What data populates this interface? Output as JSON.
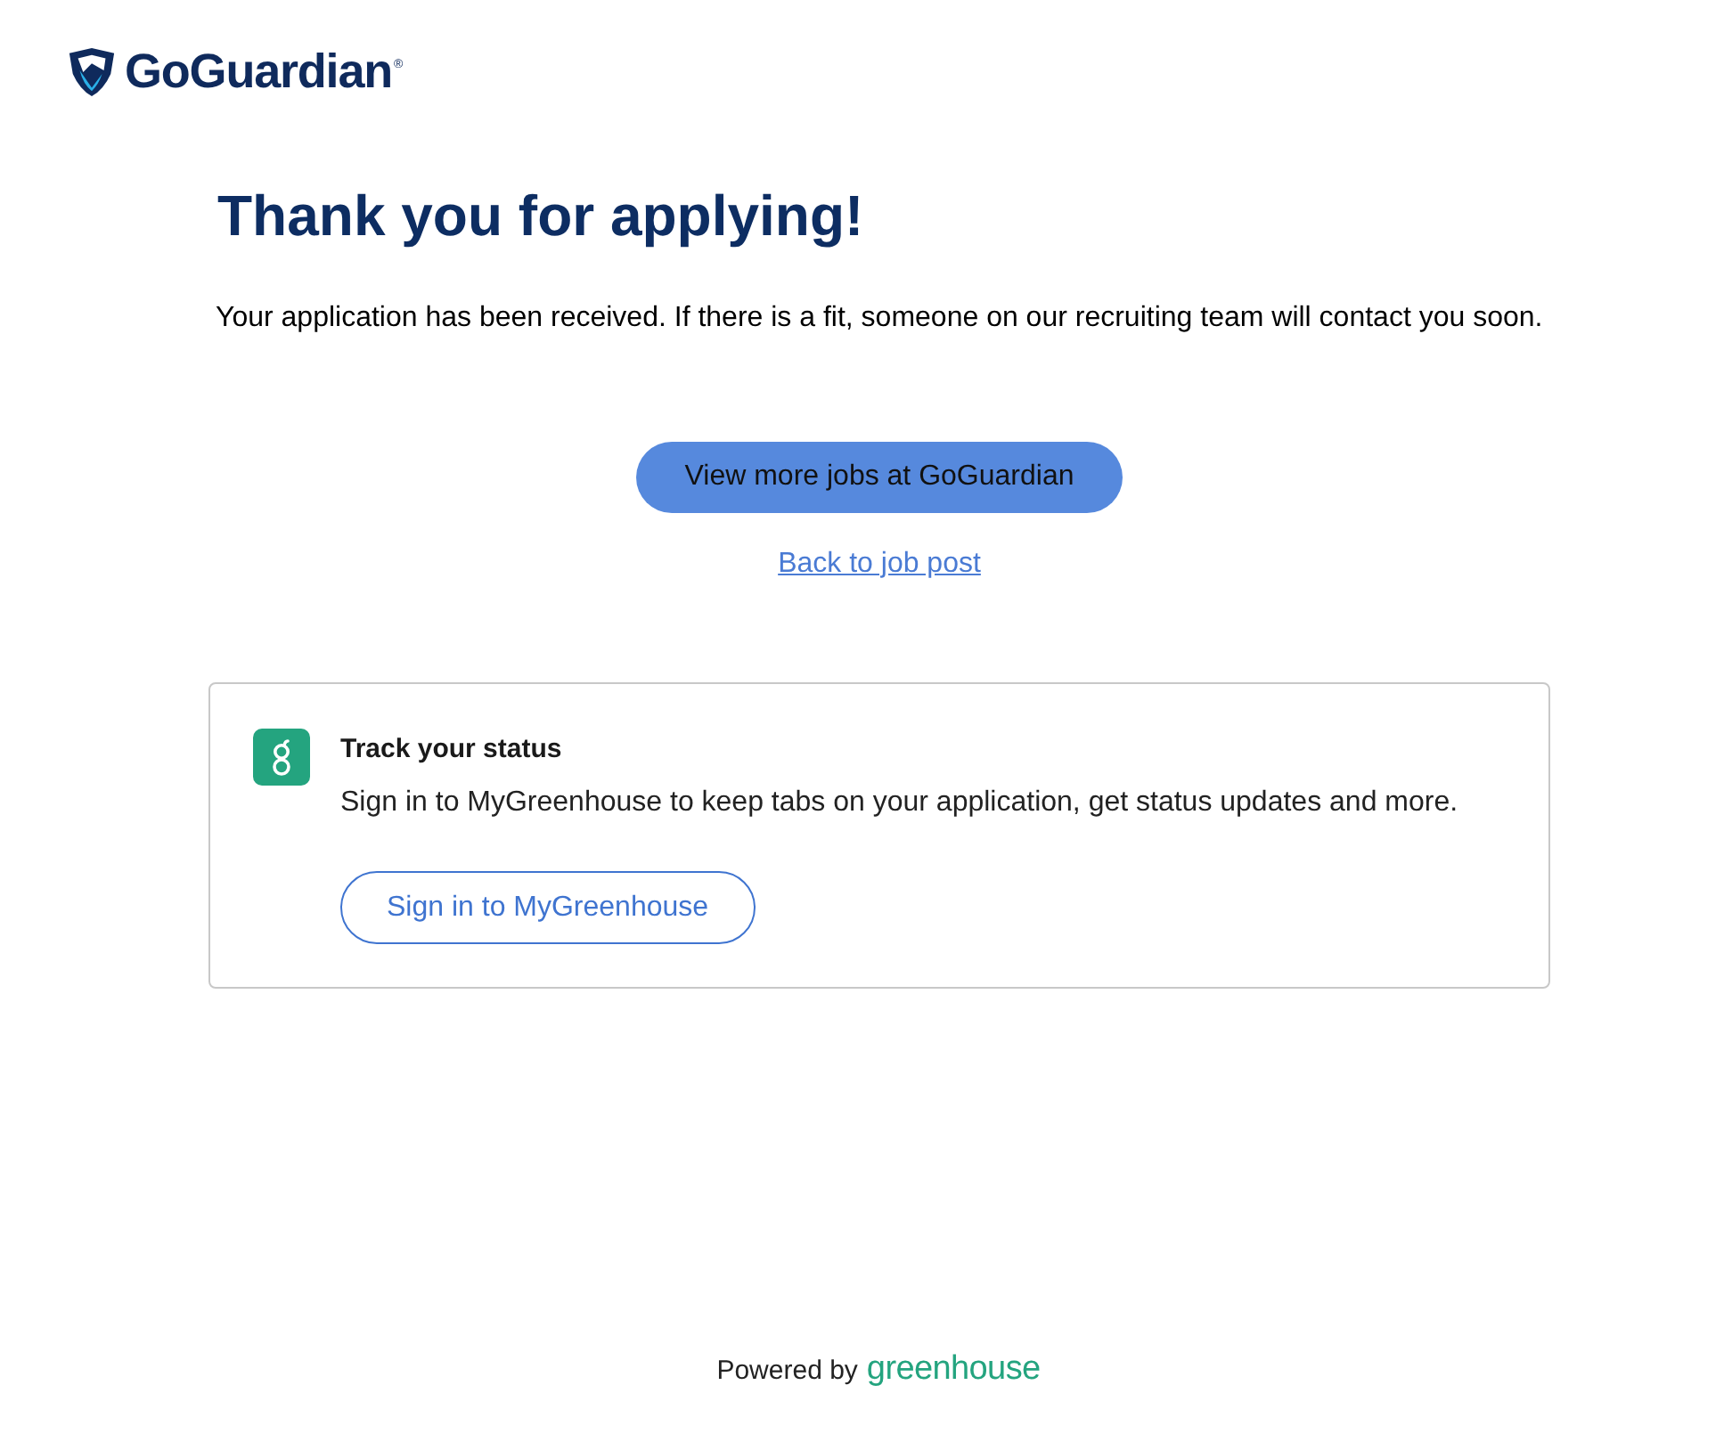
{
  "header": {
    "logo_text": "GoGuardian",
    "logo_mark": "®"
  },
  "confirmation": {
    "title": "Thank you for applying!",
    "message": "Your application has been received. If there is a fit, someone on our recruiting team will contact you soon.",
    "primary_button": "View more jobs at GoGuardian",
    "back_link": "Back to job post"
  },
  "status_card": {
    "title": "Track your status",
    "text": "Sign in to MyGreenhouse to keep tabs on your application, get status updates and more.",
    "button": "Sign in to MyGreenhouse"
  },
  "footer": {
    "prefix": "Powered by",
    "brand": "greenhouse"
  }
}
